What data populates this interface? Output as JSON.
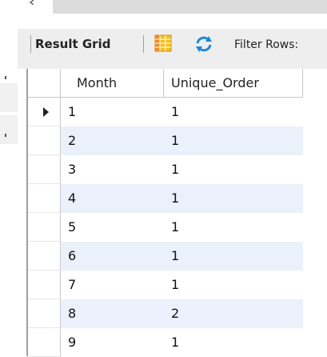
{
  "toolbar": {
    "result_grid_label": "Result Grid",
    "filter_rows_label": "Filter Rows:"
  },
  "grid": {
    "columns": [
      "Month",
      "Unique_Order"
    ],
    "rows": [
      {
        "month": "1",
        "unique_order": "1"
      },
      {
        "month": "2",
        "unique_order": "1"
      },
      {
        "month": "3",
        "unique_order": "1"
      },
      {
        "month": "4",
        "unique_order": "1"
      },
      {
        "month": "5",
        "unique_order": "1"
      },
      {
        "month": "6",
        "unique_order": "1"
      },
      {
        "month": "7",
        "unique_order": "1"
      },
      {
        "month": "8",
        "unique_order": "2"
      },
      {
        "month": "9",
        "unique_order": "1"
      }
    ],
    "current_row_index": 0
  },
  "icons": {
    "grid_icon": "grid-toggle-icon",
    "refresh_icon": "refresh-icon",
    "row_cursor": "row-pointer-icon"
  },
  "colors": {
    "toolbar_bg": "#eeeeee",
    "alt_row_bg": "#eaf1fb",
    "grid_icon_yellow": "#f4c01e",
    "grid_icon_orange": "#f08a24",
    "refresh_blue": "#1e88d8"
  }
}
